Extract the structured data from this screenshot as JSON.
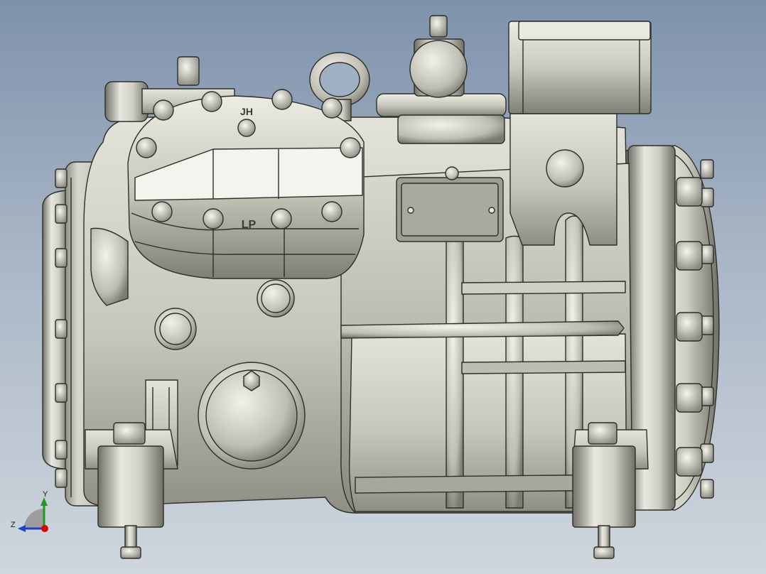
{
  "viewport": {
    "background_top": "#7e92ab",
    "background_bottom": "#cfd6dd",
    "model_base_color": "#c9c9be",
    "edge_color": "#2e2e2a"
  },
  "model": {
    "cylinder_head_marking_top": "JH",
    "cylinder_head_marking_bottom": "LP"
  },
  "triad": {
    "x_color": "#e00000",
    "y_color": "#1f9a1f",
    "z_color": "#2040d0",
    "y_label": "Y",
    "z_label": "Z"
  }
}
